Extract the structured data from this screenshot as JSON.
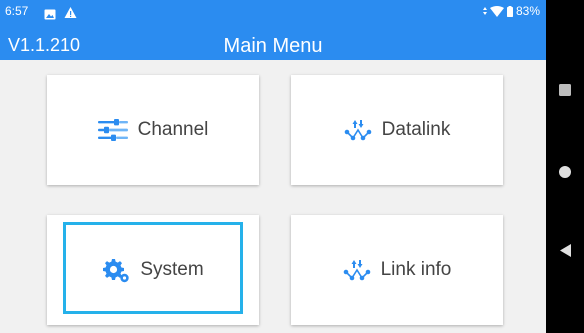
{
  "status_bar": {
    "time": "6:57",
    "battery": "83%"
  },
  "header": {
    "version": "V1.1.210",
    "title": "Main Menu"
  },
  "menu": {
    "channel": {
      "label": "Channel",
      "icon": "channel-icon"
    },
    "datalink": {
      "label": "Datalink",
      "icon": "datalink-icon"
    },
    "system": {
      "label": "System",
      "icon": "gear-icon"
    },
    "link_info": {
      "label": "Link info",
      "icon": "datalink-icon"
    }
  },
  "colors": {
    "header_bg": "#2b8cf0",
    "accent_icon": "#2b8cf0",
    "focus_ring": "#25b1ea",
    "screen_bg": "#f1f1f1"
  }
}
